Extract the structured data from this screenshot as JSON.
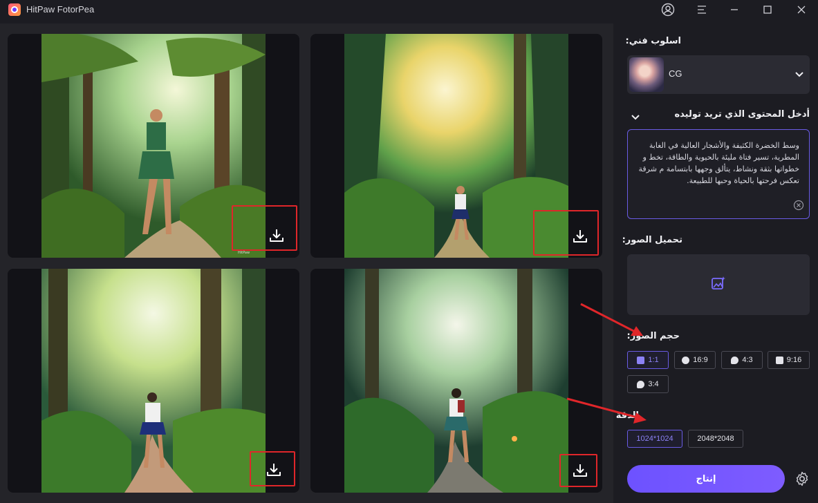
{
  "app": {
    "title": "HitPaw FotorPea"
  },
  "titlebar": {
    "user_icon": "user-circle-icon",
    "menu_icon": "menu-icon",
    "minimize_icon": "minimize-icon",
    "maximize_icon": "maximize-icon",
    "close_icon": "close-icon"
  },
  "gallery": {
    "images": [
      {
        "description_icon": "forest-image",
        "watermark": "HitPaw"
      },
      {
        "description_icon": "forest-image"
      },
      {
        "description_icon": "forest-image"
      },
      {
        "description_icon": "forest-image"
      }
    ],
    "download_icon": "download-icon",
    "highlight_color": "#e0262a"
  },
  "panel": {
    "style_label": "اسلوب فني:",
    "style_value": "CG",
    "prompt_label": "أدخل المحتوى الذي تريد توليده",
    "prompt_text": "وسط الخضرة الكثيفة والأشجار العالية في الغابة المطرية، تسير فتاة مليئة بالحيوية والطاقة، تخط و خطواتها بثقة ونشاط، يتألق وجهها بابتسامة م شرقة تعكس فرحتها بالحياة وحبها للطبيعة.",
    "upload_label": "تحميل الصور:",
    "size_label": "حجم الصور:",
    "sizes": [
      {
        "label": "1:1",
        "icon": "instagram-icon",
        "active": true
      },
      {
        "label": "16:9",
        "icon": "facebook-icon",
        "active": false
      },
      {
        "label": "4:3",
        "icon": "twitter-icon",
        "active": false
      },
      {
        "label": "9:16",
        "icon": "instagram-icon",
        "active": false
      },
      {
        "label": "3:4",
        "icon": "twitter-icon",
        "active": false
      }
    ],
    "resolution_label": "الدقة",
    "resolutions": [
      {
        "label": "1024*1024",
        "active": true
      },
      {
        "label": "2048*2048",
        "active": false
      }
    ],
    "generate_label": "إنتاج",
    "accent_color": "#6d52ff"
  }
}
